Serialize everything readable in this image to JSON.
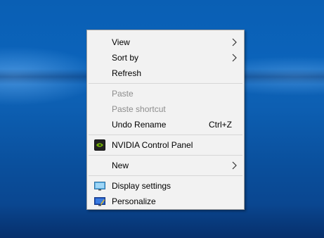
{
  "context_menu": {
    "items": [
      {
        "label": "View",
        "has_submenu": true,
        "enabled": true
      },
      {
        "label": "Sort by",
        "has_submenu": true,
        "enabled": true
      },
      {
        "label": "Refresh",
        "enabled": true
      },
      {
        "label": "Paste",
        "enabled": false
      },
      {
        "label": "Paste shortcut",
        "enabled": false
      },
      {
        "label": "Undo Rename",
        "shortcut": "Ctrl+Z",
        "enabled": true
      },
      {
        "label": "NVIDIA Control Panel",
        "icon": "nvidia-icon",
        "enabled": true
      },
      {
        "label": "New",
        "has_submenu": true,
        "enabled": true
      },
      {
        "label": "Display settings",
        "icon": "display-icon",
        "enabled": true
      },
      {
        "label": "Personalize",
        "icon": "personalize-icon",
        "enabled": true
      }
    ]
  },
  "colors": {
    "desktop_blue": "#0b5fb6",
    "menu_background": "#f2f2f2",
    "disabled_text": "#8d8d8d",
    "nvidia_green": "#76b900"
  }
}
